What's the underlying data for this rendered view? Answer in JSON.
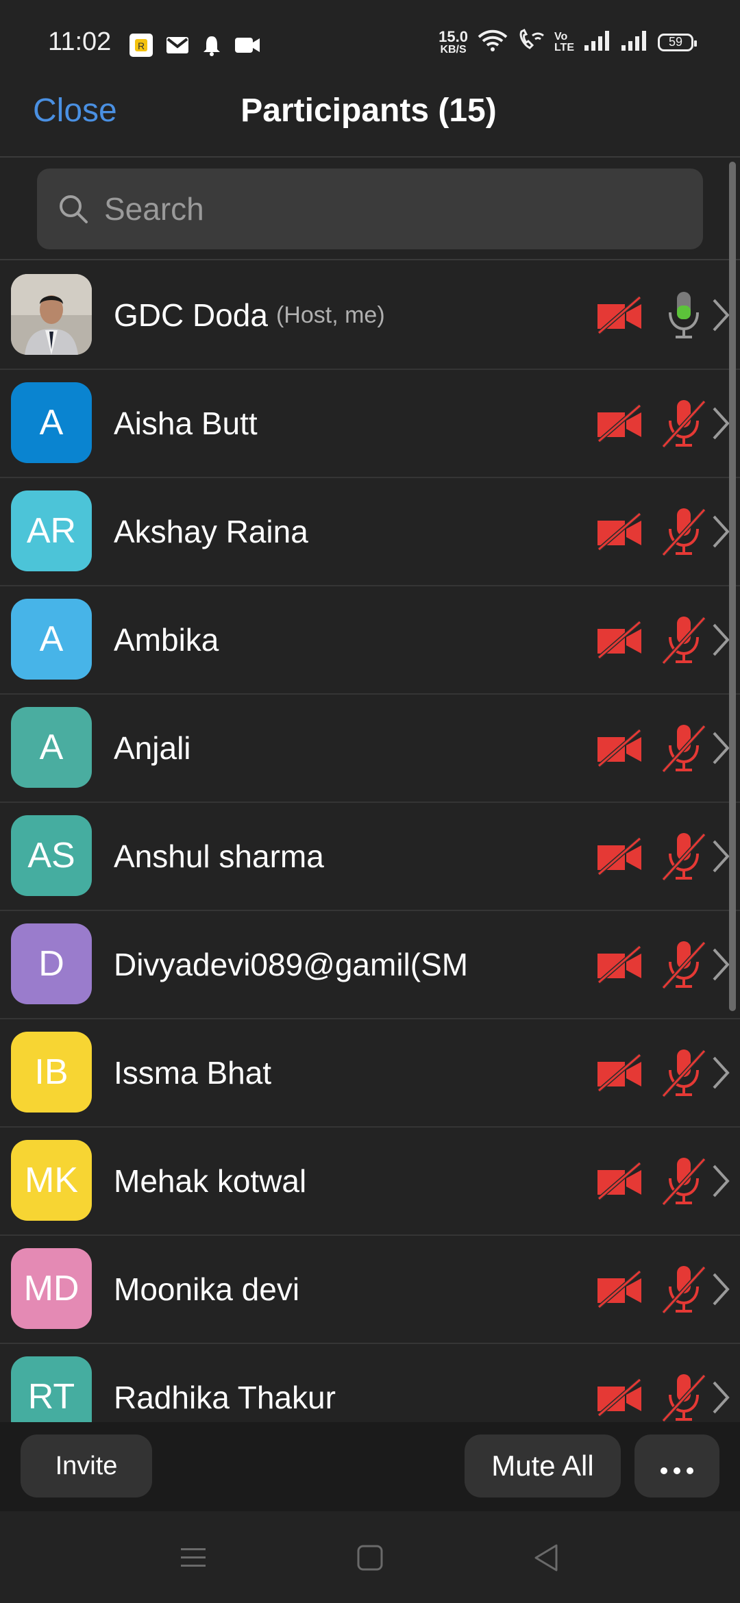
{
  "status_bar": {
    "time": "11:02",
    "net_speed_value": "15.0",
    "net_speed_unit": "KB/S",
    "volte_top": "Vo",
    "volte_bottom": "LTE",
    "battery": "59"
  },
  "header": {
    "close_label": "Close",
    "title": "Participants (15)"
  },
  "search": {
    "placeholder": "Search",
    "value": ""
  },
  "participants": [
    {
      "name": "GDC Doda",
      "role": "(Host, me)",
      "initials": "",
      "avatar_color": "#8a8a8a",
      "camera": "off",
      "mic": "on"
    },
    {
      "name": "Aisha Butt",
      "role": "",
      "initials": "A",
      "avatar_color": "#0a84d0",
      "camera": "off",
      "mic": "off"
    },
    {
      "name": "Akshay Raina",
      "role": "",
      "initials": "AR",
      "avatar_color": "#4cc4d8",
      "camera": "off",
      "mic": "off"
    },
    {
      "name": "Ambika",
      "role": "",
      "initials": "A",
      "avatar_color": "#47b4e8",
      "camera": "off",
      "mic": "off"
    },
    {
      "name": "Anjali",
      "role": "",
      "initials": "A",
      "avatar_color": "#4aada0",
      "camera": "off",
      "mic": "off"
    },
    {
      "name": "Anshul sharma",
      "role": "",
      "initials": "AS",
      "avatar_color": "#45ada0",
      "camera": "off",
      "mic": "off"
    },
    {
      "name": "Divyadevi089@gamil(SM",
      "role": "",
      "initials": "D",
      "avatar_color": "#9a7ccc",
      "camera": "off",
      "mic": "off"
    },
    {
      "name": "Issma Bhat",
      "role": "",
      "initials": "IB",
      "avatar_color": "#f7d533",
      "camera": "off",
      "mic": "off"
    },
    {
      "name": "Mehak kotwal",
      "role": "",
      "initials": "MK",
      "avatar_color": "#f7d533",
      "camera": "off",
      "mic": "off"
    },
    {
      "name": "Moonika devi",
      "role": "",
      "initials": "MD",
      "avatar_color": "#e48ab4",
      "camera": "off",
      "mic": "off"
    },
    {
      "name": "Radhika Thakur",
      "role": "",
      "initials": "RT",
      "avatar_color": "#45ada0",
      "camera": "off",
      "mic": "off"
    }
  ],
  "actions": {
    "invite_label": "Invite",
    "mute_all_label": "Mute All",
    "more_label": "•••"
  },
  "colors": {
    "accent": "#4a90e2",
    "muted_red": "#e53935",
    "mic_active_green": "#5cc33a",
    "background": "#232323"
  },
  "icons": {
    "search": "search-icon",
    "camera_off": "video-off-icon",
    "mic_off": "mic-off-icon",
    "mic_on": "mic-on-icon",
    "chevron": "chevron-right-icon",
    "more": "more-icon"
  }
}
